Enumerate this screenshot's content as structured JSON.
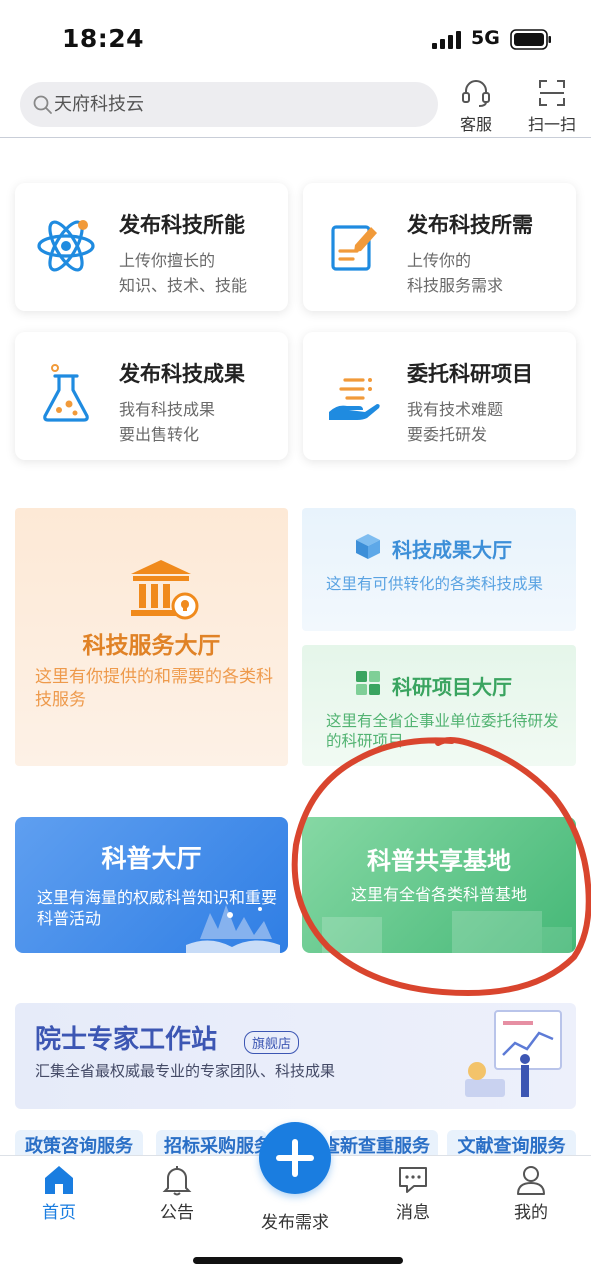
{
  "status": {
    "time": "18:24",
    "network": "5G"
  },
  "header": {
    "search_placeholder": "天府科技云",
    "service_label": "客服",
    "scan_label": "扫一扫"
  },
  "actions": [
    {
      "title": "发布科技所能",
      "line1": "上传你擅长的",
      "line2": "知识、技术、技能",
      "icon": "atom-icon"
    },
    {
      "title": "发布科技所需",
      "line1": "上传你的",
      "line2": "科技服务需求",
      "icon": "edit-document-icon"
    },
    {
      "title": "发布科技成果",
      "line1": "我有科技成果",
      "line2": "要出售转化",
      "icon": "flask-icon"
    },
    {
      "title": "委托科研项目",
      "line1": "我有技术难题",
      "line2": "要委托研发",
      "icon": "hand-task-icon"
    }
  ],
  "halls": {
    "service": {
      "title": "科技服务大厅",
      "desc": "这里有你提供的和需要的各类科技服务"
    },
    "results": {
      "title": "科技成果大厅",
      "desc": "这里有可供转化的各类科技成果"
    },
    "projects": {
      "title": "科研项目大厅",
      "desc": "这里有全省企事业单位委托待研发的科研项目"
    }
  },
  "popularization": {
    "hall": {
      "title": "科普大厅",
      "desc": "这里有海量的权威科普知识和重要科普活动"
    },
    "base": {
      "title": "科普共享基地",
      "desc": "这里有全省各类科普基地"
    }
  },
  "expert": {
    "title": "院士专家工作站",
    "badge": "旗舰店",
    "desc": "汇集全省最权威最专业的专家团队、科技成果"
  },
  "services": [
    "政策咨询服务",
    "招标采购服务",
    "查新查重服务",
    "文献查询服务"
  ],
  "nav": {
    "home": "首页",
    "notice": "公告",
    "publish": "发布需求",
    "messages": "消息",
    "mine": "我的"
  },
  "colors": {
    "primary": "#1a7de0",
    "orange": "#e08226",
    "green": "#3aa460",
    "annotation": "#d9452e"
  }
}
